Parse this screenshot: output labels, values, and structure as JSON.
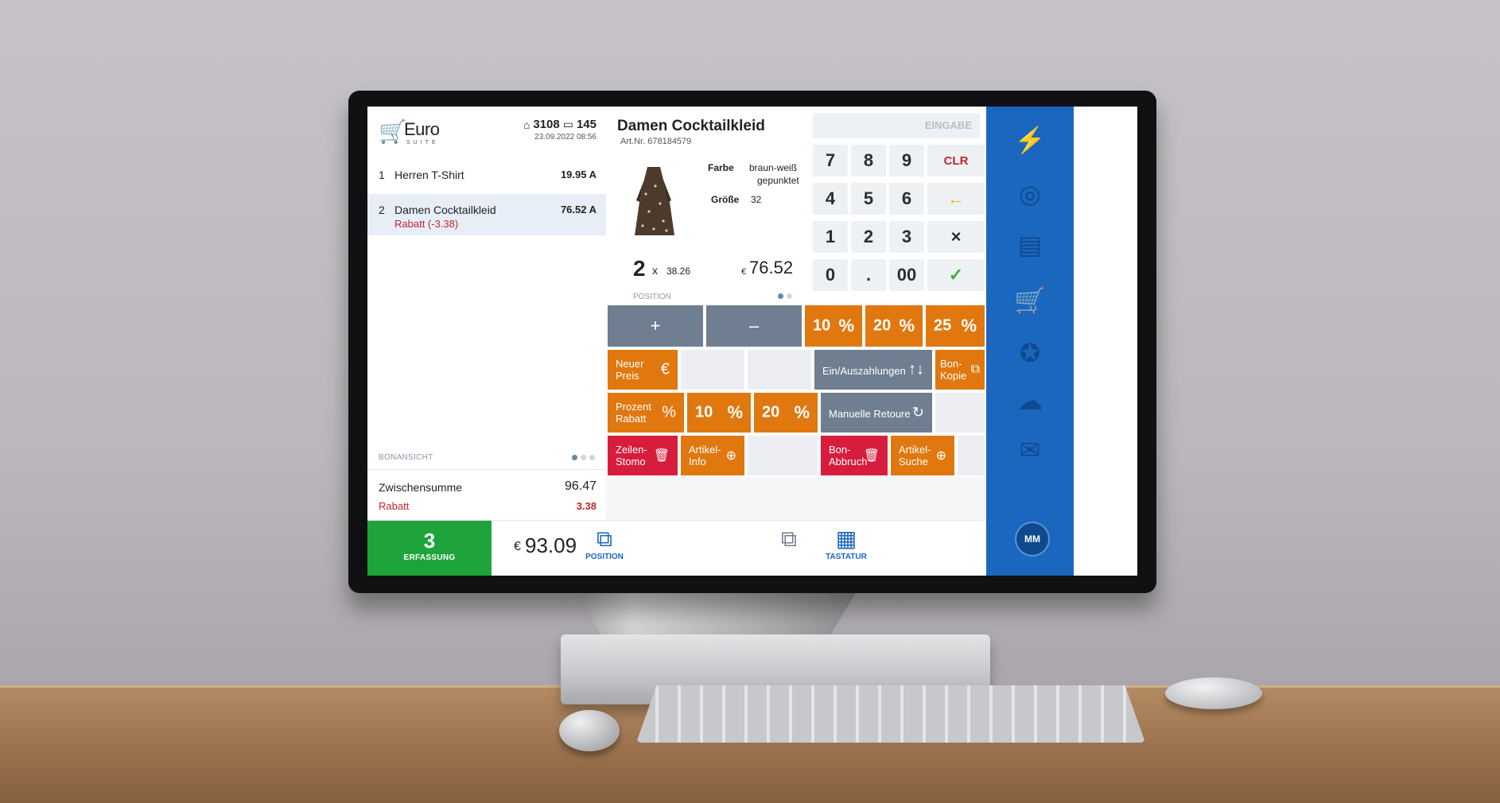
{
  "brand": {
    "logo_main": "Euro",
    "logo_sub": "SUITE"
  },
  "store": {
    "store_icon": "home-icon",
    "store_number": "3108",
    "terminal_icon": "monitor-icon",
    "terminal_number": "145",
    "datetime": "23.09.2022 08:56"
  },
  "receipt": {
    "items": [
      {
        "num": "1",
        "name": "Herren T-Shirt",
        "price": "19.95 A",
        "discount": ""
      },
      {
        "num": "2",
        "name": "Damen Cocktailkleid",
        "price": "76.52 A",
        "discount": "Rabatt (-3.38)"
      }
    ],
    "view_label": "BONANSICHT",
    "subtotal_label": "Zwischensumme",
    "subtotal_value": "96.47",
    "rabatt_label": "Rabatt",
    "rabatt_value": "3.38"
  },
  "product": {
    "title": "Damen Cocktailkleid",
    "article_no": "Art.Nr. 678184579",
    "farbe_label": "Farbe",
    "farbe_value_1": "braun-weiß",
    "farbe_value_2": "gepunktet",
    "groesse_label": "Größe",
    "groesse_value": "32",
    "qty": "2",
    "times": "x",
    "unit_price": "38.26",
    "currency": "€",
    "total": "76.52",
    "position_label": "POSITION"
  },
  "numpad": {
    "display_placeholder": "EINGABE",
    "keys": [
      "7",
      "8",
      "9",
      "CLR",
      "4",
      "5",
      "6",
      "←",
      "1",
      "2",
      "3",
      "×",
      "0",
      ".",
      "00",
      "✓"
    ]
  },
  "tiles": {
    "plus": "+",
    "minus": "–",
    "pct10": "10",
    "pct20": "20",
    "pct25": "25",
    "pct_sym": "%",
    "neuer_preis": "Neuer Preis",
    "euro_sym": "€",
    "ein_aus": "Ein/Auszahlungen",
    "ein_aus_sym": "↑↓",
    "bon_kopie": "Bon-Kopie",
    "prozent_rabatt": "Prozent Rabatt",
    "manuelle_retoure": "Manuelle Retoure",
    "zeilen_storno": "Zeilen-Stomo",
    "artikel_info": "Artikel-Info",
    "bon_abbruch": "Bon-Abbruch",
    "artikel_suche": "Artikel-Suche"
  },
  "bottom": {
    "count": "3",
    "count_label": "ERFASSUNG",
    "total_currency": "€",
    "total": "93.09",
    "position_label": "POSITION",
    "tastatur_label": "TASTATUR"
  },
  "sidebar": {
    "avatar_initials": "MM"
  },
  "colors": {
    "sidebar_blue": "#1b67c0",
    "orange": "#e0780f",
    "gray_tile": "#6f7f91",
    "red": "#d81d3c",
    "green": "#1ea43a"
  }
}
